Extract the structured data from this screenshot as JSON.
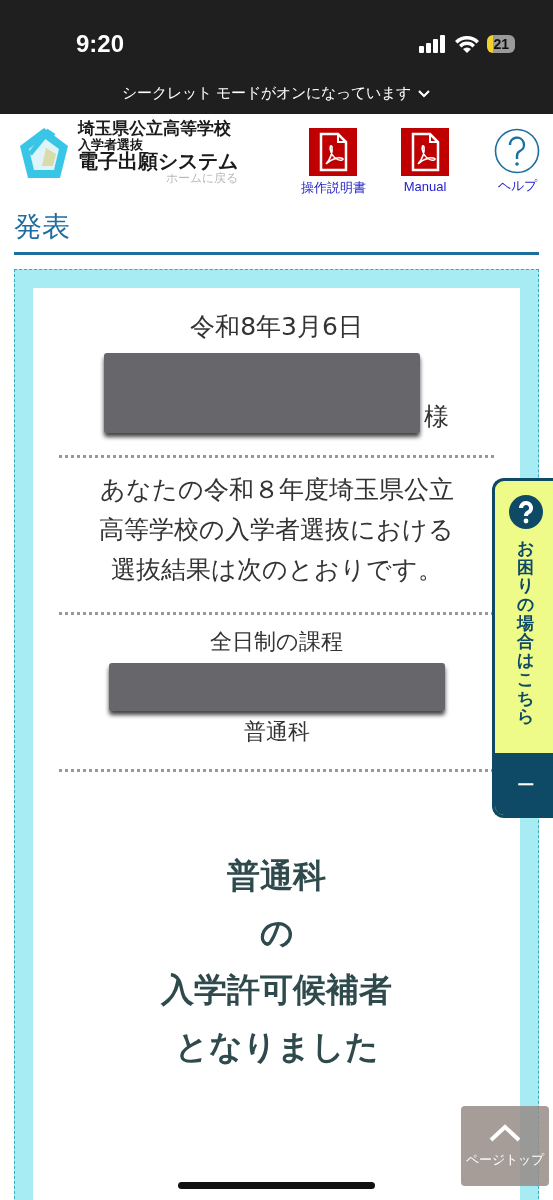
{
  "status_bar": {
    "time": "9:20",
    "battery": "21"
  },
  "incognito_banner": {
    "text": "シークレット モードがオンになっています"
  },
  "header": {
    "logo": {
      "line_1": "埼玉県公立高等学校",
      "line_2": "入学者選抜",
      "line_3": "電子出願システム",
      "home_link": "ホームに戻る"
    },
    "links": [
      {
        "kind": "pdf",
        "label": "操作説明書"
      },
      {
        "kind": "pdf",
        "label": "Manual"
      },
      {
        "kind": "help",
        "label": "ヘルプ"
      }
    ]
  },
  "page_title": "発表",
  "notice": {
    "date": "令和8年3月6日",
    "name_suffix": "様",
    "message": "あなたの令和８年度埼玉県公立高等学校の入学者選抜における選抜結果は次のとおりです。",
    "course": "全日制の課程",
    "department": "普通科",
    "result_lines": [
      "普通科",
      "の",
      "入学許可候補者",
      "となりました"
    ]
  },
  "help_tab": {
    "label": "お困りの場合はこちら",
    "toggle": "−"
  },
  "page_top": {
    "label": "ページトップ"
  }
}
